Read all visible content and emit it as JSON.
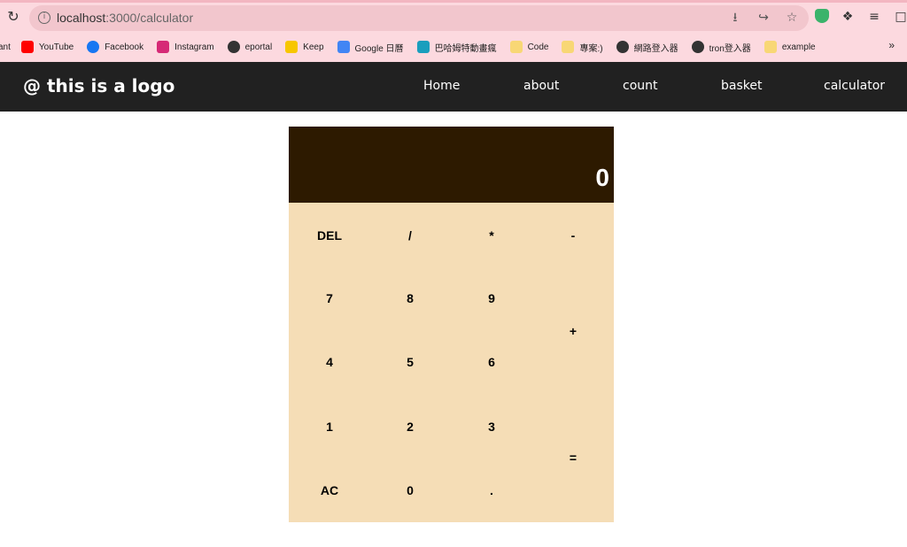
{
  "browser": {
    "url_host": "localhost",
    "url_path": ":3000/calculator",
    "bookmarks": [
      {
        "label": "ant",
        "color": ""
      },
      {
        "label": "YouTube",
        "color": "#ff0000"
      },
      {
        "label": "Facebook",
        "color": "#1877f2"
      },
      {
        "label": "Instagram",
        "color": "#d62976"
      },
      {
        "label": "eportal",
        "color": "#333333"
      },
      {
        "label": "Keep",
        "color": "#f7c600"
      },
      {
        "label": "Google 日曆",
        "color": "#4285f4"
      },
      {
        "label": "巴哈姆特動畫瘋",
        "color": "#1a9ebd"
      },
      {
        "label": "Code",
        "color": "#f8d775"
      },
      {
        "label": "專案:)",
        "color": "#f8d775"
      },
      {
        "label": "網路登入器",
        "color": "#333333"
      },
      {
        "label": "tron登入器",
        "color": "#333333"
      },
      {
        "label": "example",
        "color": "#f8d775"
      }
    ],
    "more_label": "»"
  },
  "nav": {
    "logo": "@ this is a logo",
    "links": [
      "Home",
      "about",
      "count",
      "basket",
      "calculator"
    ]
  },
  "calculator": {
    "display": "0",
    "keys": {
      "del": "DEL",
      "divide": "/",
      "multiply": "*",
      "minus": "-",
      "seven": "7",
      "eight": "8",
      "nine": "9",
      "plus": "+",
      "four": "4",
      "five": "5",
      "six": "6",
      "one": "1",
      "two": "2",
      "three": "3",
      "equals": "=",
      "ac": "AC",
      "zero": "0",
      "dot": "."
    }
  },
  "colors": {
    "navbar": "#212121",
    "display": "#2d1a00",
    "keypad": "#f5ddb6",
    "browser_chrome": "#fcd9df"
  }
}
